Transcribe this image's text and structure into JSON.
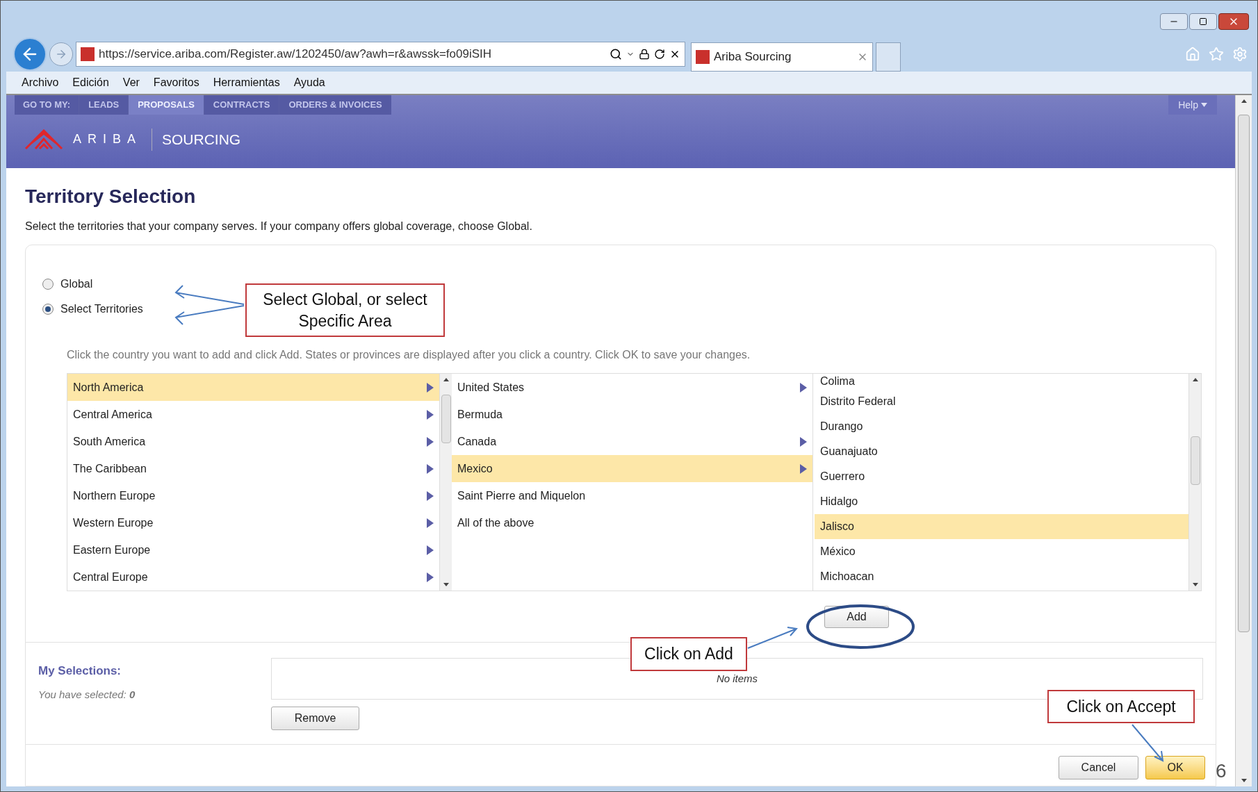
{
  "browser": {
    "url": "https://service.ariba.com/Register.aw/1202450/aw?awh=r&awssk=fo09iSIH",
    "tab_title": "Ariba Sourcing",
    "menu": [
      "Archivo",
      "Edición",
      "Ver",
      "Favoritos",
      "Herramientas",
      "Ayuda"
    ]
  },
  "nav": {
    "label": "GO TO MY:",
    "tabs": [
      {
        "label": "LEADS",
        "selected": false
      },
      {
        "label": "PROPOSALS",
        "selected": true
      },
      {
        "label": "CONTRACTS",
        "selected": false
      },
      {
        "label": "ORDERS & INVOICES",
        "selected": false
      }
    ],
    "help": "Help"
  },
  "brand": {
    "name": "ARIBA",
    "product": "SOURCING"
  },
  "title": "Territory Selection",
  "description": "Select the territories that your company serves. If your company offers global coverage, choose Global.",
  "options": [
    {
      "label": "Global",
      "selected": false
    },
    {
      "label": "Select Territories",
      "selected": true
    }
  ],
  "instruction": "Click the country you want to add and click Add. States or provinces are displayed after you click a country. Click OK to save your changes.",
  "regions": [
    {
      "label": "North America",
      "selected": true,
      "expandable": true
    },
    {
      "label": "Central America",
      "selected": false,
      "expandable": true
    },
    {
      "label": "South America",
      "selected": false,
      "expandable": true
    },
    {
      "label": "The Caribbean",
      "selected": false,
      "expandable": true
    },
    {
      "label": "Northern Europe",
      "selected": false,
      "expandable": true
    },
    {
      "label": "Western Europe",
      "selected": false,
      "expandable": true
    },
    {
      "label": "Eastern Europe",
      "selected": false,
      "expandable": true
    },
    {
      "label": "Central Europe",
      "selected": false,
      "expandable": true
    }
  ],
  "countries": [
    {
      "label": "United States",
      "selected": false,
      "expandable": true
    },
    {
      "label": "Bermuda",
      "selected": false,
      "expandable": false
    },
    {
      "label": "Canada",
      "selected": false,
      "expandable": true
    },
    {
      "label": "Mexico",
      "selected": true,
      "expandable": true
    },
    {
      "label": "Saint Pierre and Miquelon",
      "selected": false,
      "expandable": false
    },
    {
      "label": "All of the above",
      "selected": false,
      "expandable": false
    }
  ],
  "states": [
    {
      "label": "Colima",
      "selected": false
    },
    {
      "label": "Distrito Federal",
      "selected": false
    },
    {
      "label": "Durango",
      "selected": false
    },
    {
      "label": "Guanajuato",
      "selected": false
    },
    {
      "label": "Guerrero",
      "selected": false
    },
    {
      "label": "Hidalgo",
      "selected": false
    },
    {
      "label": "Jalisco",
      "selected": true
    },
    {
      "label": "México",
      "selected": false
    },
    {
      "label": "Michoacan",
      "selected": false
    }
  ],
  "add_button": "Add",
  "selections": {
    "title": "My Selections:",
    "summary": "You have selected: **0**",
    "empty": "No items",
    "remove": "Remove"
  },
  "footer_buttons": [
    {
      "label": "Cancel",
      "kind": "secondary"
    },
    {
      "label": "OK",
      "kind": "primary"
    }
  ],
  "annotations": [
    "Select Global, or select Specific Area",
    "Click on Add",
    "Click on Accept"
  ],
  "page_number": "6"
}
